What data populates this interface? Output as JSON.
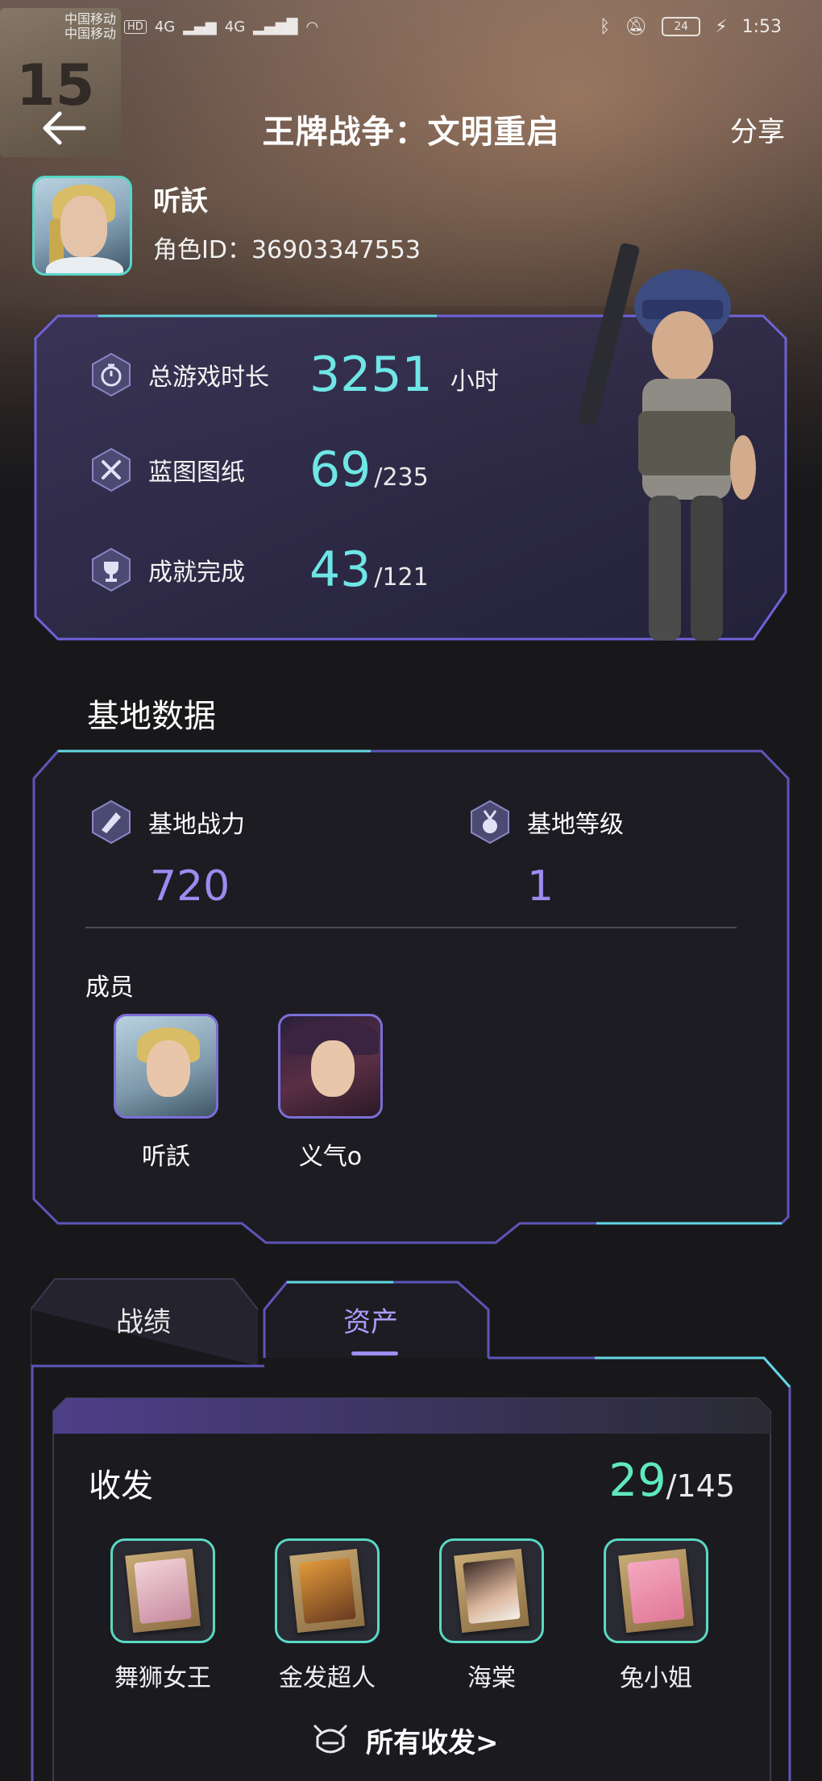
{
  "status_bar": {
    "carrier1": "中国移动",
    "carrier2": "中国移动",
    "hd": "HD",
    "net1": "4G",
    "net2": "4G",
    "battery": "24",
    "time": "1:53"
  },
  "nav": {
    "title": "王牌战争：文明重启",
    "share_label": "分享"
  },
  "profile": {
    "name": "听訞",
    "id_label": "角色ID：",
    "id_value": "36903347553"
  },
  "stats": {
    "playtime": {
      "label": "总游戏时长",
      "value": "3251",
      "unit": "小时"
    },
    "blueprints": {
      "label": "蓝图图纸",
      "value": "69",
      "total": "/235"
    },
    "achievements": {
      "label": "成就完成",
      "value": "43",
      "total": "/121"
    }
  },
  "base": {
    "section_title": "基地数据",
    "power": {
      "label": "基地战力",
      "value": "720"
    },
    "level": {
      "label": "基地等级",
      "value": "1"
    },
    "members_title": "成员",
    "members": [
      {
        "name": "听訞"
      },
      {
        "name": "义气o"
      }
    ]
  },
  "tabs": {
    "record": "战绩",
    "assets": "资产",
    "active": "assets"
  },
  "hairstyles": {
    "title": "收发",
    "count": "29",
    "total": "/145",
    "items": [
      {
        "name": "舞狮女王"
      },
      {
        "name": "金发超人"
      },
      {
        "name": "海棠"
      },
      {
        "name": "兔小姐"
      }
    ],
    "all_label": "所有收发>"
  },
  "colors": {
    "accent_cyan": "#6fe6e6",
    "accent_purple": "#9a8cf0",
    "accent_green": "#5fe8c0",
    "background": "#18181b"
  }
}
